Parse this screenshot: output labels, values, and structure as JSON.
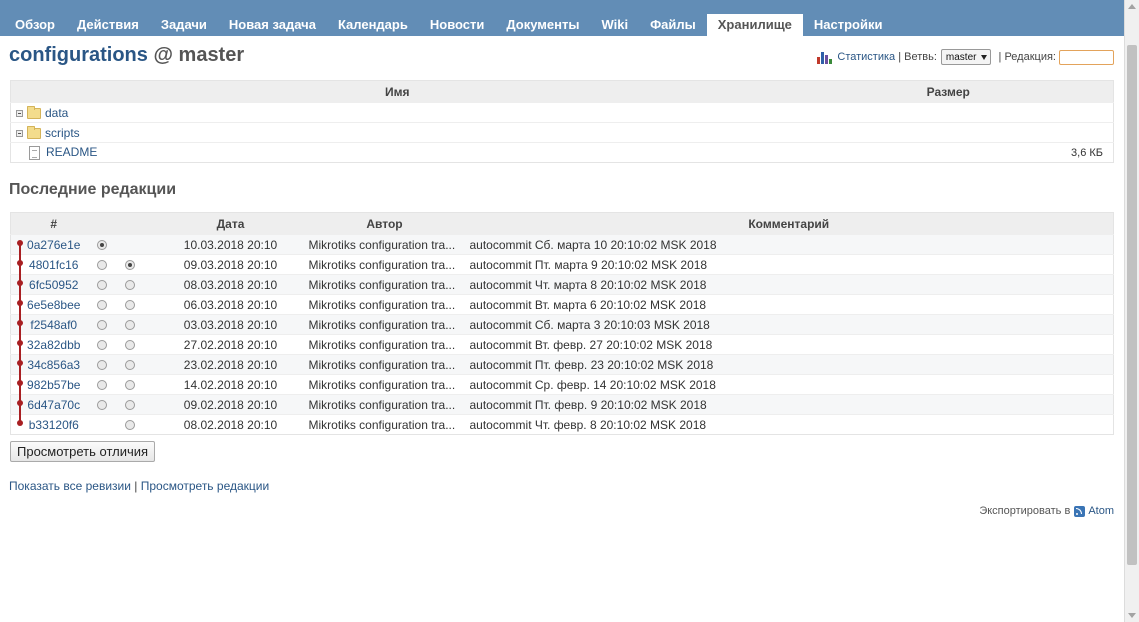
{
  "menu": {
    "tabs": [
      {
        "label": "Обзор"
      },
      {
        "label": "Действия"
      },
      {
        "label": "Задачи"
      },
      {
        "label": "Новая задача"
      },
      {
        "label": "Календарь"
      },
      {
        "label": "Новости"
      },
      {
        "label": "Документы"
      },
      {
        "label": "Wiki"
      },
      {
        "label": "Файлы"
      },
      {
        "label": "Хранилище",
        "selected": true
      },
      {
        "label": "Настройки"
      }
    ]
  },
  "title": {
    "repo": "configurations",
    "separator": "@",
    "branch": "master"
  },
  "toolbar": {
    "stats_icon": "bar-chart-icon",
    "stats_label": "Статистика",
    "sep1": " | ",
    "branch_label": "Ветвь:",
    "branch_value": "master",
    "sep2": " | ",
    "revision_label": "Редакция:",
    "revision_value": ""
  },
  "entries": {
    "headers": {
      "name": "Имя",
      "size": "Размер"
    },
    "rows": [
      {
        "name": "data",
        "type": "folder",
        "size": ""
      },
      {
        "name": "scripts",
        "type": "folder",
        "size": ""
      },
      {
        "name": "README",
        "type": "file",
        "size": "3,6 КБ"
      }
    ]
  },
  "revisions_section": {
    "heading": "Последние редакции",
    "headers": {
      "rev": "#",
      "date": "Дата",
      "author": "Автор",
      "comment": "Комментарий"
    },
    "rows": [
      {
        "rev": "0a276e1e",
        "radio1": true,
        "radio1_checked": true,
        "radio2": false,
        "radio2_checked": false,
        "date": "10.03.2018 20:10",
        "author": "Mikrotiks configuration tra...",
        "comment": "autocommit Сб. марта 10 20:10:02 MSK 2018"
      },
      {
        "rev": "4801fc16",
        "radio1": true,
        "radio1_checked": false,
        "radio2": true,
        "radio2_checked": true,
        "date": "09.03.2018 20:10",
        "author": "Mikrotiks configuration tra...",
        "comment": "autocommit Пт. марта 9 20:10:02 MSK 2018"
      },
      {
        "rev": "6fc50952",
        "radio1": true,
        "radio1_checked": false,
        "radio2": true,
        "radio2_checked": false,
        "date": "08.03.2018 20:10",
        "author": "Mikrotiks configuration tra...",
        "comment": "autocommit Чт. марта 8 20:10:02 MSK 2018"
      },
      {
        "rev": "6e5e8bee",
        "radio1": true,
        "radio1_checked": false,
        "radio2": true,
        "radio2_checked": false,
        "date": "06.03.2018 20:10",
        "author": "Mikrotiks configuration tra...",
        "comment": "autocommit Вт. марта 6 20:10:02 MSK 2018"
      },
      {
        "rev": "f2548af0",
        "radio1": true,
        "radio1_checked": false,
        "radio2": true,
        "radio2_checked": false,
        "date": "03.03.2018 20:10",
        "author": "Mikrotiks configuration tra...",
        "comment": "autocommit Сб. марта 3 20:10:03 MSK 2018"
      },
      {
        "rev": "32a82dbb",
        "radio1": true,
        "radio1_checked": false,
        "radio2": true,
        "radio2_checked": false,
        "date": "27.02.2018 20:10",
        "author": "Mikrotiks configuration tra...",
        "comment": "autocommit Вт. февр. 27 20:10:02 MSK 2018"
      },
      {
        "rev": "34c856a3",
        "radio1": true,
        "radio1_checked": false,
        "radio2": true,
        "radio2_checked": false,
        "date": "23.02.2018 20:10",
        "author": "Mikrotiks configuration tra...",
        "comment": "autocommit Пт. февр. 23 20:10:02 MSK 2018"
      },
      {
        "rev": "982b57be",
        "radio1": true,
        "radio1_checked": false,
        "radio2": true,
        "radio2_checked": false,
        "date": "14.02.2018 20:10",
        "author": "Mikrotiks configuration tra...",
        "comment": "autocommit Ср. февр. 14 20:10:02 MSK 2018"
      },
      {
        "rev": "6d47a70c",
        "radio1": true,
        "radio1_checked": false,
        "radio2": true,
        "radio2_checked": false,
        "date": "09.02.2018 20:10",
        "author": "Mikrotiks configuration tra...",
        "comment": "autocommit Пт. февр. 9 20:10:02 MSK 2018"
      },
      {
        "rev": "b33120f6",
        "radio1": false,
        "radio1_checked": false,
        "radio2": true,
        "radio2_checked": false,
        "date": "08.02.2018 20:10",
        "author": "Mikrotiks configuration tra...",
        "comment": "autocommit Чт. февр. 8 20:10:02 MSK 2018"
      }
    ]
  },
  "actions": {
    "diff_button": "Просмотреть отличия",
    "show_all": "Показать все ревизии",
    "links_sep": " | ",
    "view_revisions": "Просмотреть редакции"
  },
  "export": {
    "label": "Экспортировать в",
    "feed_icon": "rss-feed-icon",
    "atom": "Atom"
  },
  "colors": {
    "header_bg": "#628db6",
    "link": "#2a5685",
    "graph": "#a81f22"
  }
}
